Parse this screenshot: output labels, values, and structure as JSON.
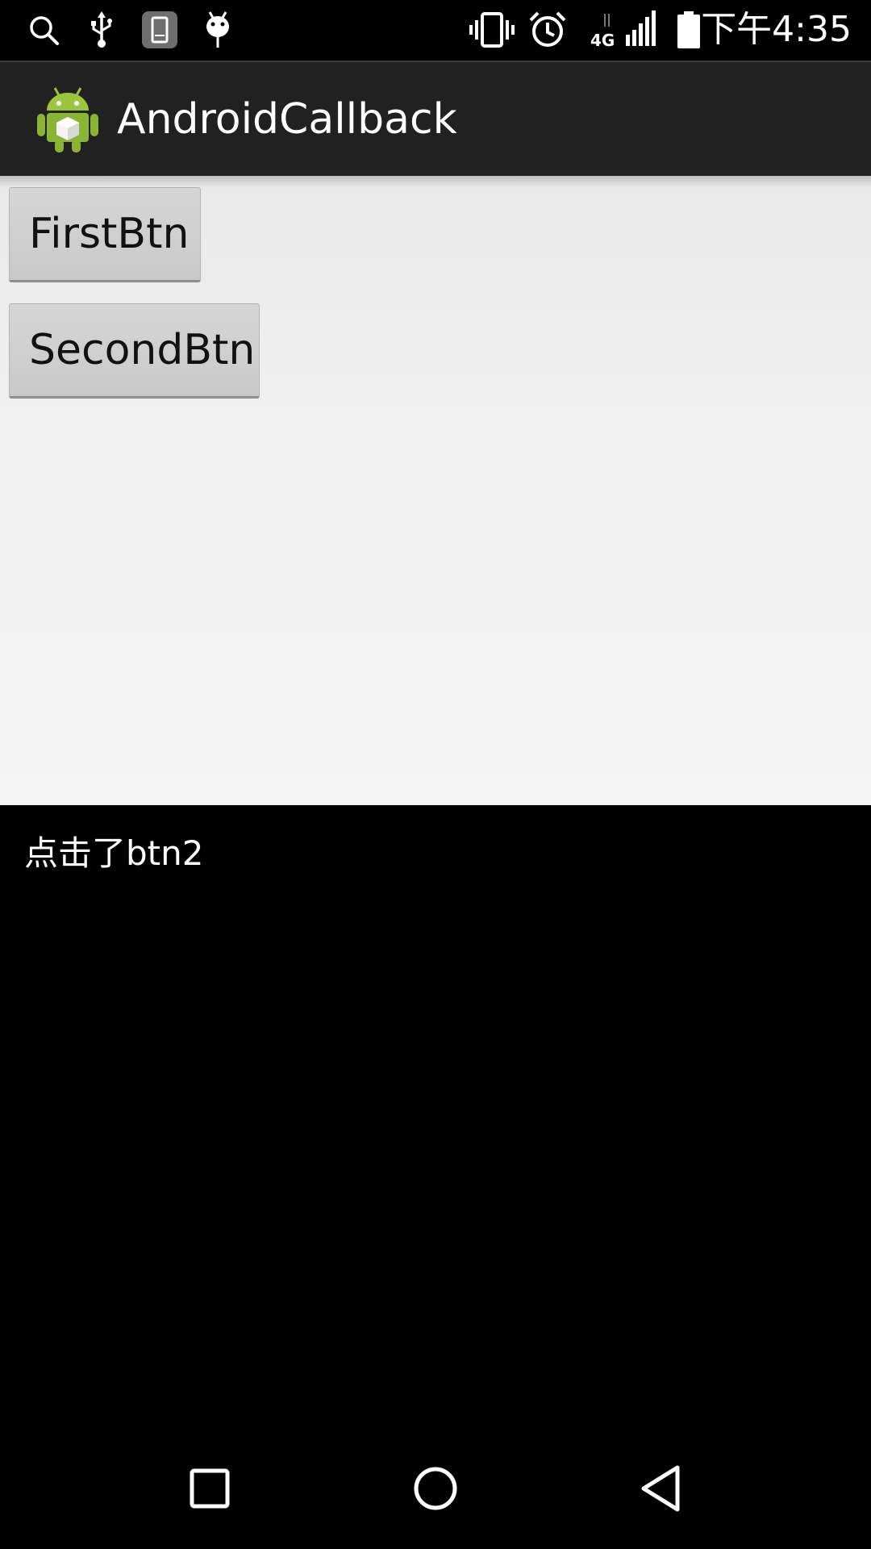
{
  "status_bar": {
    "time": "下午4:35",
    "network_type": "4G",
    "left_icons": [
      "search-icon",
      "usb-icon",
      "phone-icon",
      "android-debug-icon"
    ],
    "right_icons": [
      "vibrate-icon",
      "alarm-icon",
      "signal-icon",
      "battery-icon"
    ]
  },
  "action_bar": {
    "title": "AndroidCallback",
    "icon": "android-app-icon"
  },
  "buttons": {
    "first_label": "FirstBtn",
    "second_label": "SecondBtn"
  },
  "log": {
    "message": "点击了btn2"
  },
  "nav_bar": {
    "icons": [
      "recents-icon",
      "home-icon",
      "back-icon"
    ]
  },
  "colors": {
    "action_bar_bg": "#212121",
    "content_bg": "#f0f0f0",
    "button_bg": "#cfcfcf",
    "log_bg": "#000000",
    "android_green": "#9bc53d"
  }
}
